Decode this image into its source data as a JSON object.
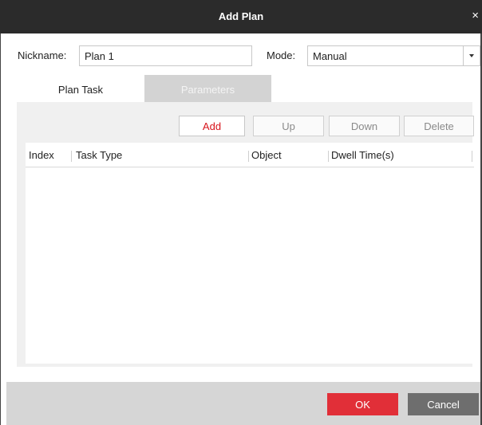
{
  "dialog": {
    "title": "Add Plan",
    "close_glyph": "×"
  },
  "form": {
    "nickname_label": "Nickname:",
    "nickname_value": "Plan 1",
    "mode_label": "Mode:",
    "mode_value": "Manual"
  },
  "tabs": [
    {
      "label": "Plan Task",
      "active": true
    },
    {
      "label": "Parameters",
      "active": false
    }
  ],
  "toolbar": {
    "add_label": "Add",
    "up_label": "Up",
    "down_label": "Down",
    "delete_label": "Delete"
  },
  "table": {
    "columns": [
      "Index",
      "Task Type",
      "Object",
      "Dwell Time(s)"
    ],
    "rows": []
  },
  "footer": {
    "ok_label": "OK",
    "cancel_label": "Cancel"
  },
  "colors": {
    "titlebar": "#2b2b2b",
    "accent_red": "#e12f38",
    "cancel_gray": "#6e6e6e",
    "panel": "#f0f0f0"
  },
  "icons": {
    "close": "close-icon",
    "dropdown": "chevron-down-icon"
  }
}
